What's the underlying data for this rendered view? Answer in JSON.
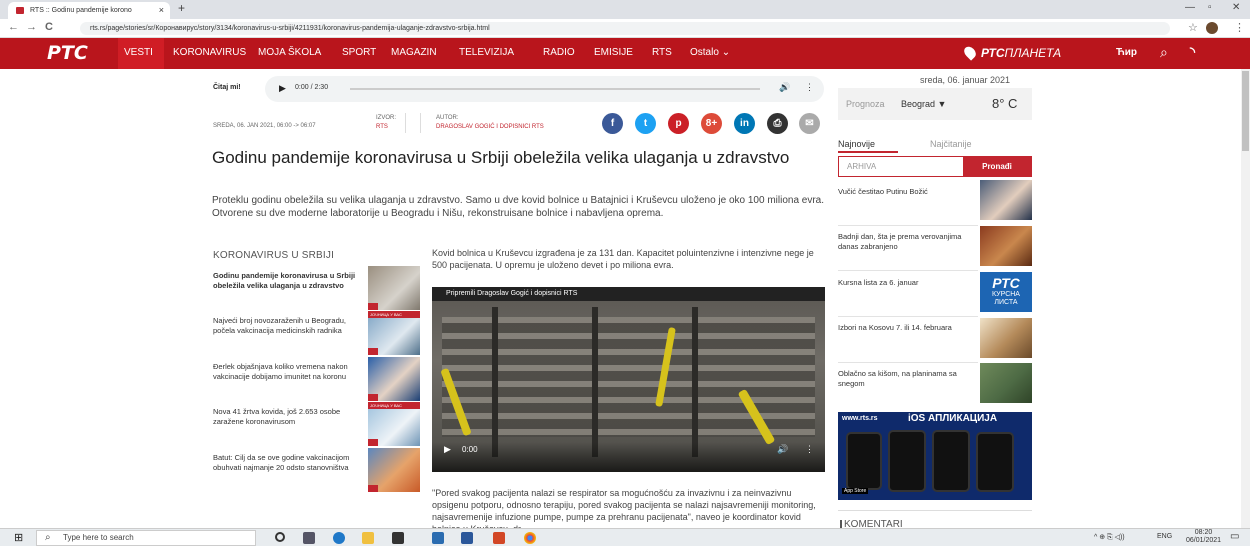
{
  "browser": {
    "tab_title": "RTS :: Godinu pandemije korono",
    "tab_close": "×",
    "new_tab": "+",
    "url": "rts.rs/page/stories/sr/Коронавирус/story/3134/koronavirus-u-srbiji/4211931/koronavirus-pandemija-ulaganje-zdravstvo-srbija.html",
    "back": "←",
    "forward": "→",
    "reload": "C",
    "lock": "🔒",
    "star": "☆",
    "menu": "⋮",
    "min": "—",
    "max": "▫",
    "close": "✕"
  },
  "nav": {
    "logo": "РТС",
    "items": [
      "VESTI",
      "KORONAVIRUS",
      "MOJA ŠKOLA",
      "SPORT",
      "MAGAZIN",
      "TELEVIZIJA",
      "RADIO",
      "EMISIJE",
      "RTS",
      "Ostalo"
    ],
    "chevron": "⌄",
    "planeta_bold": "РТС",
    "planeta_rest": "ПЛАНЕТА",
    "cyr": "Ћир",
    "search": "⌕",
    "rss": "◝"
  },
  "article": {
    "citaj": "Čitaj mi!",
    "audio_time": "0:00 / 2:30",
    "play": "▶",
    "volume": "🔊",
    "audio_menu": "⋮",
    "date": "SREDA, 06. JAN 2021, 06:00 -> 06:07",
    "izvor_label": "IZVOR:",
    "izvor": "RTS",
    "autor_label": "AUTOR:",
    "autor": "DRAGOSLAV GOGIĆ I DOPISNICI RTS",
    "share": [
      "f",
      "t",
      "p",
      "8+",
      "in",
      "⎙",
      "✉"
    ],
    "title": "Godinu pandemije koronavirusa u Srbiji obeležila velika ulaganja u zdravstvo",
    "lead": "Proteklu godinu obeležila su velika ulaganja u zdravstvo. Samo u dve kovid bolnice u Batajnici i Kruševcu uloženo je oko 100 miliona evra. Otvorene su dve moderne laboratorije u Beogradu i Nišu, rekonstruisane bolnice i nabavljena oprema.",
    "body1": "Kovid bolnica u Kruševcu izgrađena je za 131 dan. Kapacitet poluintenzivne i intenzivne nege je 500 pacijenata. U opremu je uloženo devet i po miliona evra.",
    "video_caption": "Pripremili Dragoslav Gogić i dopisnici RTS",
    "video_time": "0:00",
    "video_play": "▶",
    "video_vol": "🔊",
    "video_menu": "⋮",
    "body2": "\"Pored svakog pacijenta nalazi se respirator sa mogućnošću za invazivnu i za neinvazivnu opsigenu potporu, odnosno terapiju, pored svakog pacijenta se nalazi najsavremeniji monitoring, najsavremenije infuzione pumpe, pumpe za prehranu pacijenata\", naveo je koordinator kovid bolnice u Kruševcu, dr"
  },
  "related": {
    "title": "KORONAVIRUS U SRBIJI",
    "thumb_label": "ЈОЧНИЦА У ВАС",
    "items": [
      "Godinu pandemije koronavirusa u Srbiji obeležila velika ulaganja u zdravstvo",
      "Najveći broj novozaraženih u Beogradu, počela vakcinacija medicinskih radnika",
      "Đerlek objašnjava koliko vremena nakon vakcinacije dobijamo imunitet na koronu",
      "Nova 41 žrtva kovida, još 2.653 osobe zaražene koronavirusom",
      "Batut: Cilj da se ove godine vakcinacijom obuhvati najmanje 20 odsto stanovništva"
    ]
  },
  "sidebar": {
    "date": "sreda, 06. januar 2021",
    "prognoza": "Prognoza",
    "city": "Beograd",
    "city_caret": "▼",
    "temp": "8° C",
    "tab_najnovije": "Najnovije",
    "tab_najcitanije": "Najčitanije",
    "search_placeholder": "ARHIVA",
    "search_button": "Pronađi",
    "news": [
      "Vučić čestitao Putinu Božić",
      "Badnji dan, šta je prema verovanjima danas zabranjeno",
      "Kursna lista za 6. januar",
      "Izbori na Kosovu 7. ili 14. februara",
      "Oblačno sa kišom, na planinama sa snegom"
    ],
    "kursna_logo": "РТС",
    "kursna_text": "КУРСНА ЛИСТА",
    "ios_site": "www.rts.rs",
    "ios_title": "iOS АПЛИКАЦИЈА",
    "app_store": "App Store",
    "komentari": "KOMENTARI"
  },
  "taskbar": {
    "start": "⊞",
    "search": "Type here to search",
    "search_icon": "⌕",
    "tray_icons": "^ ⊕ ⎘ ◁))",
    "lang": "ENG",
    "time": "08:20",
    "date": "06/01/2021",
    "notif": "▭"
  },
  "colors": {
    "brand_red": "#b9151c",
    "accent_red": "#c2252f",
    "facebook": "#3b5998",
    "twitter": "#1da1f2",
    "pinterest": "#cb2027",
    "gplus": "#dd4b39",
    "linkedin": "#0077b5",
    "print": "#333333",
    "mail": "#aaaaaa"
  }
}
